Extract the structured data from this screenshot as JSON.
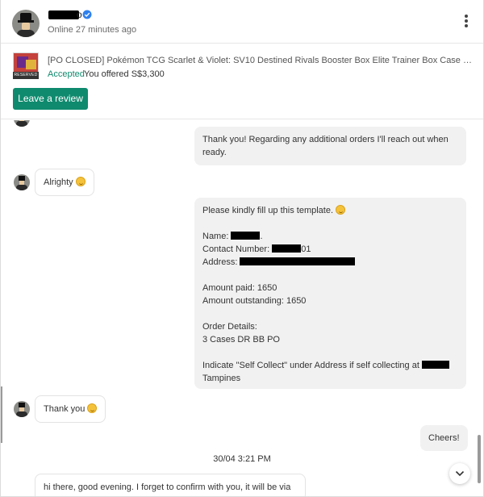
{
  "header": {
    "user_name_tail": "o",
    "online_status": "Online 27 minutes ago",
    "icons": {
      "verified": "verified-badge-icon",
      "more": "more-vertical-icon"
    }
  },
  "listing": {
    "reserved_tag": "RESERVED",
    "title": "[PO CLOSED] Pokémon TCG Scarlet & Violet: SV10 Destined Rivals Booster Box Elite Trainer Box Case 100% Al...",
    "status": "Accepted",
    "offer": "You offered S$3,300",
    "review_button": "Leave a review"
  },
  "messages": {
    "m1": {
      "line1": "Thank you! Regarding any additional orders I'll reach out when",
      "line2": "ready."
    },
    "m2": {
      "text": "Alrighty"
    },
    "m3": {
      "intro": "Please kindly fill up this template.",
      "name_label": "Name:",
      "contact_label": "Contact Number:",
      "contact_tail": "01",
      "address_label": "Address:",
      "amount_paid": "Amount paid: 1650",
      "amount_outstanding": "Amount outstanding: 1650",
      "order_details_label": "Order Details:",
      "order_details": "3 Cases DR BB PO",
      "indicate_line": "Indicate \"Self Collect\" under Address if self collecting at",
      "location": "Tampines"
    },
    "m4": {
      "text": "Thank you"
    },
    "m5": {
      "text": "Cheers!"
    },
    "date_separator": "30/04  3:21 PM",
    "m6": {
      "text": "hi there, good evening. I forget to confirm with you, it will be via"
    }
  },
  "icons": {
    "emoji": "smiling-face-emoji-icon",
    "scroll_down": "chevron-down-icon"
  },
  "colors": {
    "accent": "#0f8a6e",
    "bubble_out": "#f1f1f1"
  }
}
